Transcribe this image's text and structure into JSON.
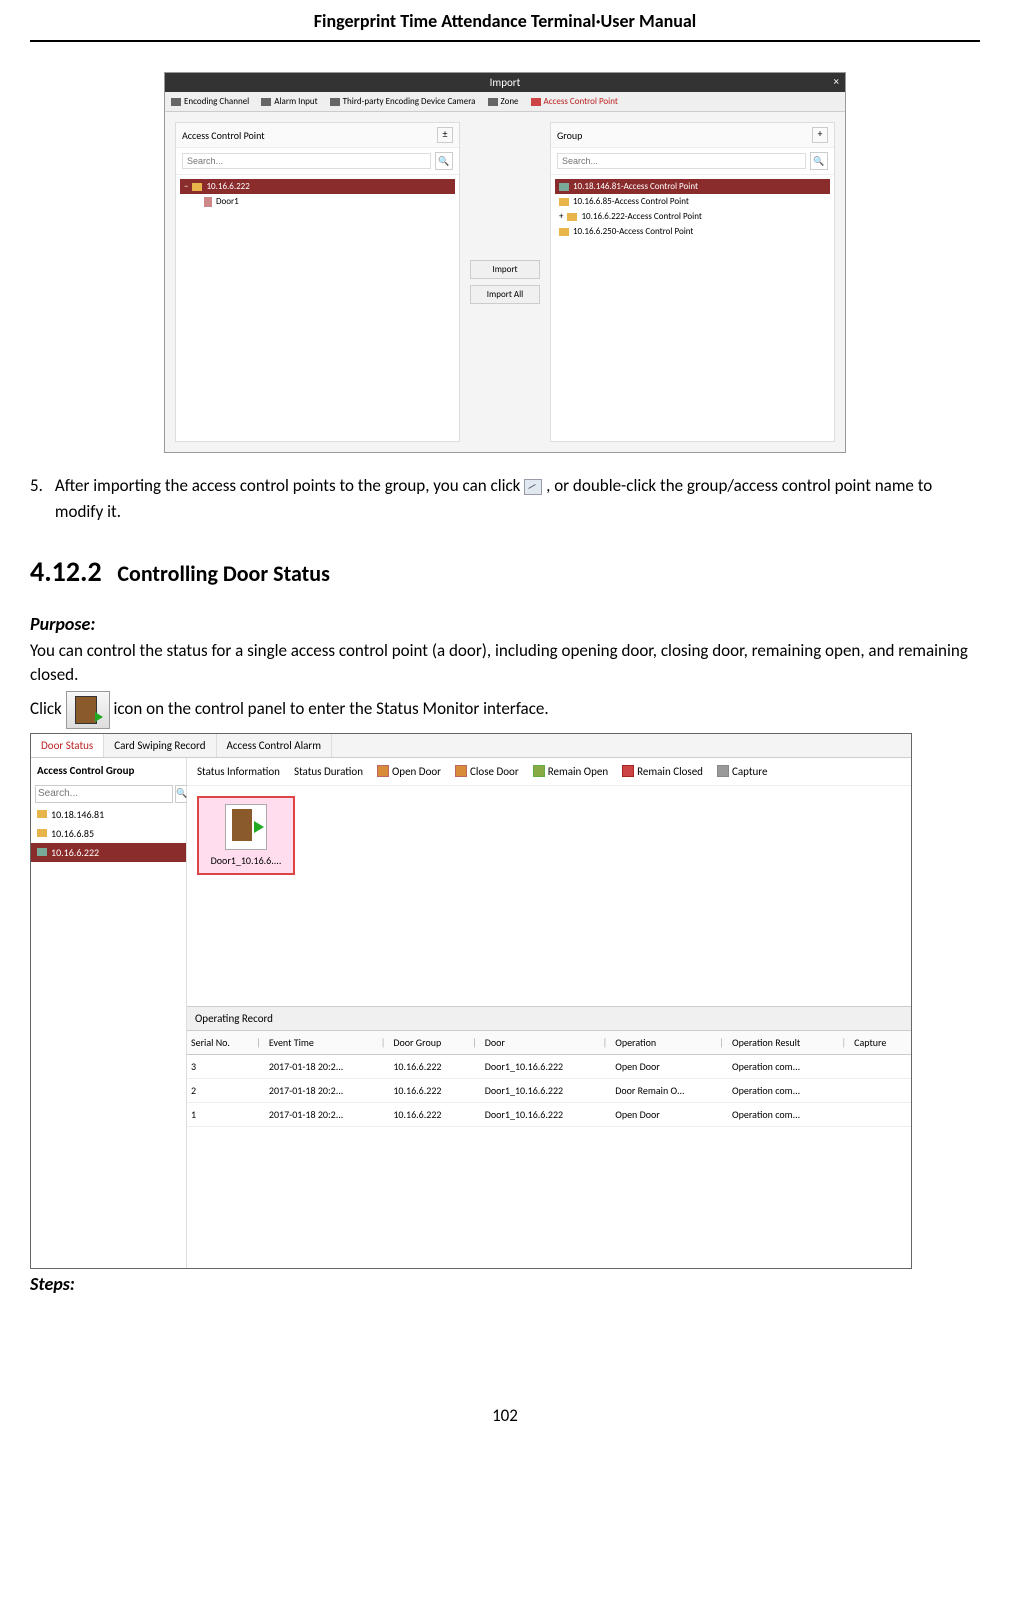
{
  "header_title": "Fingerprint Time Attendance Terminal·User Manual",
  "import_dialog": {
    "title": "Import",
    "close": "×",
    "tabs": [
      "Encoding Channel",
      "Alarm Input",
      "Third-party Encoding Device Camera",
      "Zone",
      "Access Control Point"
    ],
    "left_panel": {
      "title": "Access Control Point",
      "search_placeholder": "Search...",
      "tree": {
        "root": "10.16.6.222",
        "child": "Door1"
      }
    },
    "center_buttons": [
      "Import",
      "Import All"
    ],
    "right_panel": {
      "title": "Group",
      "search_placeholder": "Search...",
      "items": [
        "10.18.146.81-Access Control Point",
        "10.16.6.85-Access Control Point",
        "10.16.6.222-Access Control Point",
        "10.16.6.250-Access Control Point"
      ]
    }
  },
  "step5": {
    "num": "5.",
    "text_a": "After importing the access control points to the group, you can click ",
    "text_b": ", or double-click the group/access control point name to modify it."
  },
  "section": {
    "num": "4.12.2",
    "title": "Controlling Door Status"
  },
  "purpose_label": "Purpose:",
  "purpose_text": "You can control the status for a single access control point (a door), including opening door, closing door, remaining open, and remaining closed.",
  "click_text_a": "Click ",
  "click_text_b": " icon on the control panel to enter the Status Monitor interface.",
  "status_monitor": {
    "tabs": [
      "Door Status",
      "Card Swiping Record",
      "Access Control Alarm"
    ],
    "sidebar": {
      "title": "Access Control Group",
      "search_placeholder": "Search...",
      "items": [
        "10.18.146.81",
        "10.16.6.85",
        "10.16.6.222"
      ]
    },
    "toolbar": [
      "Status Information",
      "Status Duration",
      "Open Door",
      "Close Door",
      "Remain Open",
      "Remain Closed",
      "Capture"
    ],
    "door_tile": "Door1_10.16.6....",
    "operating_record_label": "Operating Record",
    "columns": [
      "Serial No.",
      "Event Time",
      "Door Group",
      "Door",
      "Operation",
      "Operation Result",
      "Capture"
    ],
    "rows": [
      {
        "serial": "3",
        "time": "2017-01-18 20:2...",
        "group": "10.16.6.222",
        "door": "Door1_10.16.6.222",
        "op": "Open Door",
        "result": "Operation com...",
        "capture": ""
      },
      {
        "serial": "2",
        "time": "2017-01-18 20:2...",
        "group": "10.16.6.222",
        "door": "Door1_10.16.6.222",
        "op": "Door Remain O...",
        "result": "Operation com...",
        "capture": ""
      },
      {
        "serial": "1",
        "time": "2017-01-18 20:2...",
        "group": "10.16.6.222",
        "door": "Door1_10.16.6.222",
        "op": "Open Door",
        "result": "Operation com...",
        "capture": ""
      }
    ]
  },
  "steps_label": "Steps:",
  "page_number": "102"
}
